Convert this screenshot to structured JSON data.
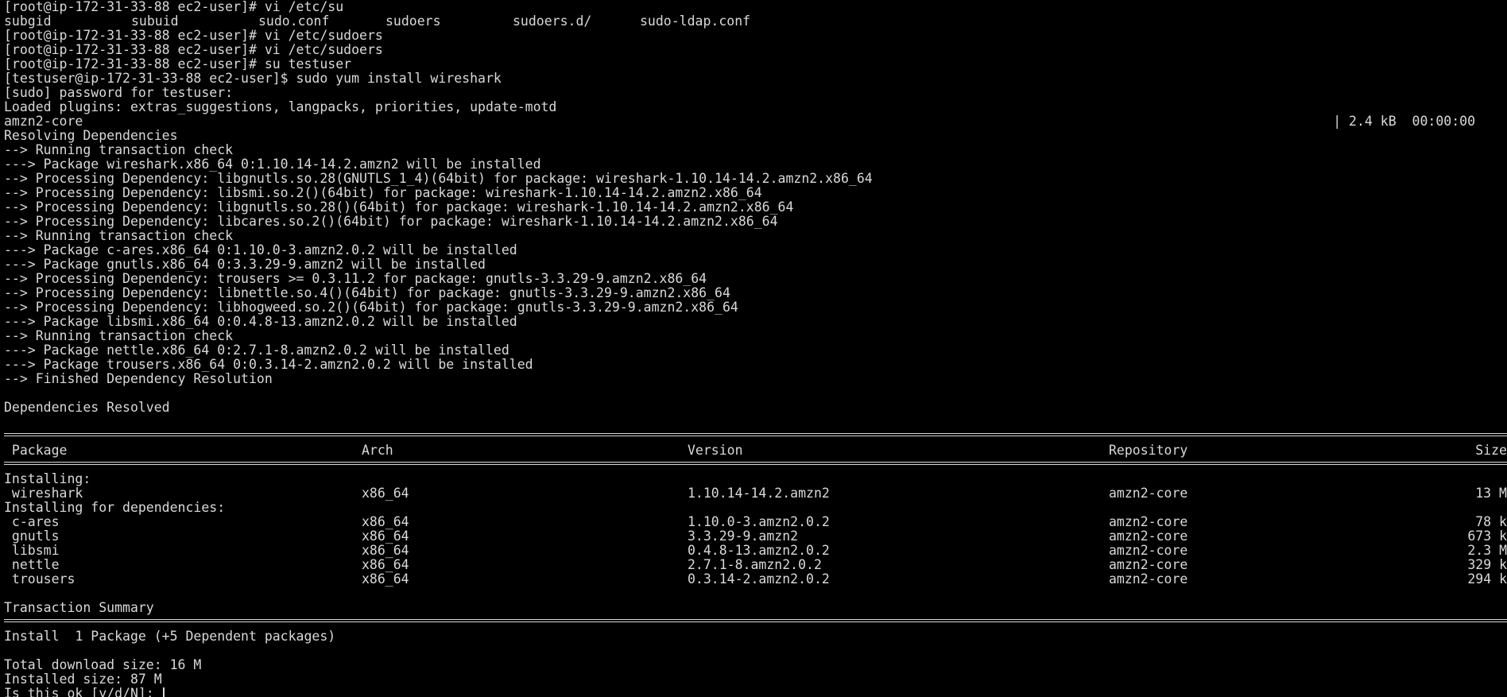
{
  "terminal": {
    "lines_top": [
      "[root@ip-172-31-33-88 ec2-user]# vi /etc/su"
    ],
    "completions": [
      "subgid",
      "subuid",
      "sudo.conf",
      "sudoers",
      "sudoers.d/",
      "sudo-ldap.conf"
    ],
    "lines_mid": [
      "[root@ip-172-31-33-88 ec2-user]# vi /etc/sudoers",
      "[root@ip-172-31-33-88 ec2-user]# vi /etc/sudoers",
      "[root@ip-172-31-33-88 ec2-user]# su testuser",
      "[testuser@ip-172-31-33-88 ec2-user]$ sudo yum install wireshark",
      "[sudo] password for testuser:",
      "Loaded plugins: extras_suggestions, langpacks, priorities, update-motd"
    ],
    "repo_line": {
      "name": "amzn2-core",
      "progress": "| 2.4 kB  00:00:00"
    },
    "lines_resolve": [
      "Resolving Dependencies",
      "--> Running transaction check",
      "---> Package wireshark.x86_64 0:1.10.14-14.2.amzn2 will be installed",
      "--> Processing Dependency: libgnutls.so.28(GNUTLS_1_4)(64bit) for package: wireshark-1.10.14-14.2.amzn2.x86_64",
      "--> Processing Dependency: libsmi.so.2()(64bit) for package: wireshark-1.10.14-14.2.amzn2.x86_64",
      "--> Processing Dependency: libgnutls.so.28()(64bit) for package: wireshark-1.10.14-14.2.amzn2.x86_64",
      "--> Processing Dependency: libcares.so.2()(64bit) for package: wireshark-1.10.14-14.2.amzn2.x86_64",
      "--> Running transaction check",
      "---> Package c-ares.x86_64 0:1.10.0-3.amzn2.0.2 will be installed",
      "---> Package gnutls.x86_64 0:3.3.29-9.amzn2 will be installed",
      "--> Processing Dependency: trousers >= 0.3.11.2 for package: gnutls-3.3.29-9.amzn2.x86_64",
      "--> Processing Dependency: libnettle.so.4()(64bit) for package: gnutls-3.3.29-9.amzn2.x86_64",
      "--> Processing Dependency: libhogweed.so.2()(64bit) for package: gnutls-3.3.29-9.amzn2.x86_64",
      "---> Package libsmi.x86_64 0:0.4.8-13.amzn2.0.2 will be installed",
      "--> Running transaction check",
      "---> Package nettle.x86_64 0:2.7.1-8.amzn2.0.2 will be installed",
      "---> Package trousers.x86_64 0:0.3.14-2.amzn2.0.2 will be installed",
      "--> Finished Dependency Resolution"
    ],
    "deps_resolved": "Dependencies Resolved",
    "table": {
      "headers": {
        "package": " Package",
        "arch": "Arch",
        "version": "Version",
        "repository": "Repository",
        "size": "Size"
      },
      "installing_label": "Installing:",
      "installing": [
        {
          "package": " wireshark",
          "arch": "x86_64",
          "version": "1.10.14-14.2.amzn2",
          "repository": "amzn2-core",
          "size": "13 M"
        }
      ],
      "deps_label": "Installing for dependencies:",
      "deps": [
        {
          "package": " c-ares",
          "arch": "x86_64",
          "version": "1.10.0-3.amzn2.0.2",
          "repository": "amzn2-core",
          "size": "78 k"
        },
        {
          "package": " gnutls",
          "arch": "x86_64",
          "version": "3.3.29-9.amzn2",
          "repository": "amzn2-core",
          "size": "673 k"
        },
        {
          "package": " libsmi",
          "arch": "x86_64",
          "version": "0.4.8-13.amzn2.0.2",
          "repository": "amzn2-core",
          "size": "2.3 M"
        },
        {
          "package": " nettle",
          "arch": "x86_64",
          "version": "2.7.1-8.amzn2.0.2",
          "repository": "amzn2-core",
          "size": "329 k"
        },
        {
          "package": " trousers",
          "arch": "x86_64",
          "version": "0.3.14-2.amzn2.0.2",
          "repository": "amzn2-core",
          "size": "294 k"
        }
      ]
    },
    "summary_title": "Transaction Summary",
    "summary_install": "Install  1 Package (+5 Dependent packages)",
    "total_download": "Total download size: 16 M",
    "installed_size": "Installed size: 87 M",
    "prompt": "Is this ok [y/d/N]: "
  }
}
